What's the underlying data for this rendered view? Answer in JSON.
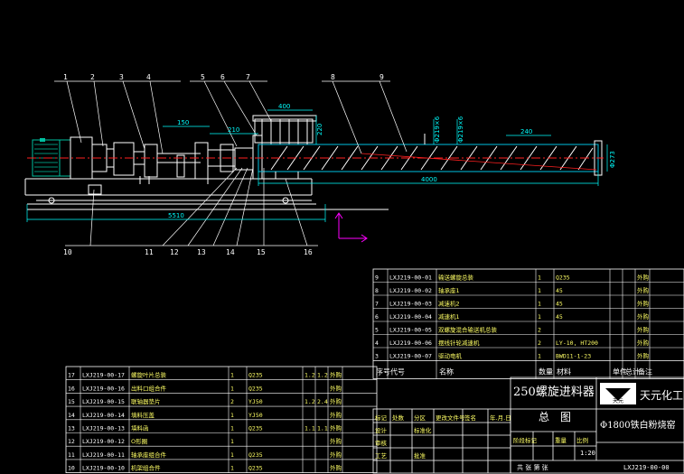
{
  "colors": {
    "background": "#000000",
    "outline": "#ffffff",
    "shaft": "#ff2020",
    "dimension": "#00ffff",
    "motor": "#00c0a0",
    "trough": "#00c0e0",
    "axis": "#ff00ff",
    "bom_text": "#ffff66"
  },
  "balloons": [
    "1",
    "2",
    "3",
    "4",
    "5",
    "6",
    "7",
    "8",
    "9",
    "10",
    "11",
    "12",
    "13",
    "14",
    "15",
    "16"
  ],
  "dims": {
    "d150": "150",
    "d210": "210",
    "d400": "400",
    "d240": "240",
    "d4000": "4000",
    "d5510": "5510",
    "d220": "220",
    "v1": "Φ219×6",
    "v2": "Φ219×6",
    "v3": "Φ273"
  },
  "parts_upper": {
    "rows": [
      {
        "no": "9",
        "code": "LXJ219-00-01",
        "name": "输送螺旋总装",
        "qty": "1",
        "mat": "Q235",
        "w1": "",
        "w2": "",
        "note": "外购"
      },
      {
        "no": "8",
        "code": "LXJ219-00-02",
        "name": "轴承座1",
        "qty": "1",
        "mat": "45",
        "w1": "",
        "w2": "",
        "note": "外购"
      },
      {
        "no": "7",
        "code": "LXJ219-00-03",
        "name": "减速机2",
        "qty": "1",
        "mat": "45",
        "w1": "",
        "w2": "",
        "note": "外购"
      },
      {
        "no": "6",
        "code": "LXJ219-00-04",
        "name": "减速机1",
        "qty": "1",
        "mat": "45",
        "w1": "",
        "w2": "",
        "note": "外购"
      },
      {
        "no": "5",
        "code": "LXJ219-00-05",
        "name": "双螺旋混合输送机总装",
        "qty": "2",
        "mat": "",
        "w1": "",
        "w2": "",
        "note": "外购"
      },
      {
        "no": "4",
        "code": "LXJ219-00-06",
        "name": "摆线针轮减速机",
        "qty": "2",
        "mat": "LY-10, HT200",
        "w1": "",
        "w2": "",
        "note": "外购"
      },
      {
        "no": "3",
        "code": "LXJ219-00-07",
        "name": "驱动电机",
        "qty": "1",
        "mat": "BWD11-1-23",
        "w1": "",
        "w2": "",
        "note": "外购"
      }
    ],
    "header": {
      "no": "序号",
      "code": "代号",
      "name": "名称",
      "qty": "数量",
      "mat": "材料",
      "w1": "单件",
      "w2": "总计",
      "note": "备注",
      "weight": "重量"
    }
  },
  "parts_lower": {
    "rows": [
      {
        "no": "17",
        "code": "LXJ219-00-17",
        "name": "螺旋叶片总装",
        "qty": "1",
        "mat": "Q235",
        "w1": "1.2",
        "w2": "1.2",
        "note": "外购"
      },
      {
        "no": "16",
        "code": "LXJ219-00-16",
        "name": "出料口组合件",
        "qty": "1",
        "mat": "Q235",
        "w1": "",
        "w2": "",
        "note": "外购"
      },
      {
        "no": "15",
        "code": "LXJ219-00-15",
        "name": "联轴器垫片",
        "qty": "2",
        "mat": "YJ50",
        "w1": "1.2",
        "w2": "2.4",
        "note": "外购"
      },
      {
        "no": "14",
        "code": "LXJ219-00-14",
        "name": "填料压盖",
        "qty": "1",
        "mat": "YJ50",
        "w1": "",
        "w2": "",
        "note": "外购"
      },
      {
        "no": "13",
        "code": "LXJ219-00-13",
        "name": "填料函",
        "qty": "1",
        "mat": "Q235",
        "w1": "1.1",
        "w2": "1.1",
        "note": "外购"
      },
      {
        "no": "12",
        "code": "LXJ219-00-12",
        "name": "O形圈",
        "qty": "1",
        "mat": "",
        "w1": "",
        "w2": "",
        "note": "外购"
      },
      {
        "no": "11",
        "code": "LXJ219-00-11",
        "name": "轴承座组合件",
        "qty": "1",
        "mat": "Q235",
        "w1": "",
        "w2": "",
        "note": "外购"
      },
      {
        "no": "10",
        "code": "LXJ219-00-10",
        "name": "机架组合件",
        "qty": "1",
        "mat": "Q235",
        "w1": "",
        "w2": "",
        "note": "外购"
      }
    ]
  },
  "title_block": {
    "product": "250螺旋进料器",
    "drawing": "总　图",
    "company": "天元化工",
    "logo_text": "天元",
    "customer": "Φ1800铁白粉烧窑",
    "drawing_no": "LXJ219-00-00",
    "scale": "1:20",
    "sheet": "共 张 第 张",
    "labels": [
      "标记",
      "处数",
      "分区",
      "更改文件号",
      "签名",
      "年.月.日",
      "设计",
      "标准化",
      "审核",
      "工艺",
      "批准",
      "阶段标记",
      "重量",
      "比例"
    ]
  }
}
